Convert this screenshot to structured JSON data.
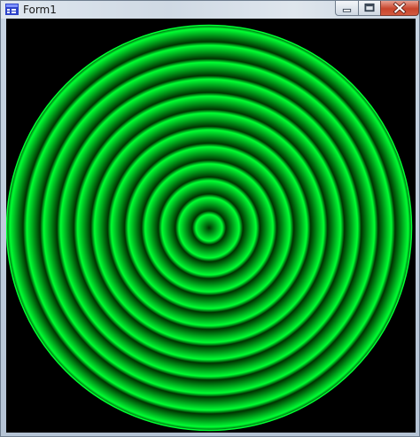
{
  "window": {
    "title": "Form1",
    "app_icon": "delphi-form-icon",
    "controls": {
      "minimize_icon": "minimize-icon",
      "maximize_icon": "maximize-icon",
      "close_icon": "close-icon"
    }
  },
  "canvas": {
    "background_color": "#000000",
    "ring_bright_color": "#00ff33",
    "ring_dark_color": "#003300",
    "ring_count": 12,
    "pattern": "concentric-gradient-rings"
  }
}
